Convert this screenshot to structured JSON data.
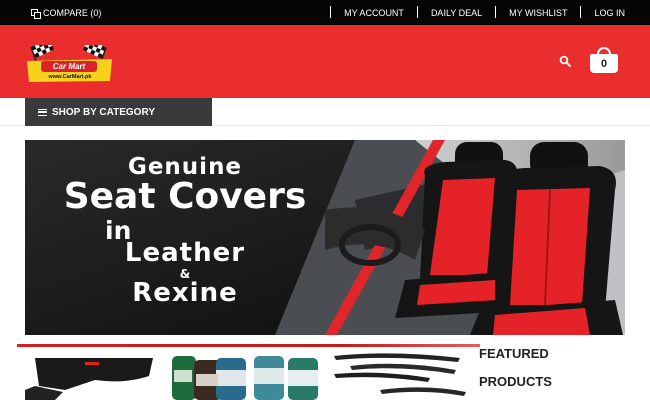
{
  "topbar": {
    "compare_label": "COMPARE (0)",
    "links": [
      "MY ACCOUNT",
      "DAILY DEAL",
      "MY WISHLIST",
      "LOG IN"
    ]
  },
  "header": {
    "logo_text": "Car Mart",
    "logo_url_text": "www.CarMart.pk",
    "cart_count": "0"
  },
  "nav": {
    "category_label": "SHOP BY CATEGORY"
  },
  "banner": {
    "line1": "Genuine",
    "line2": "Seat Covers",
    "line3": "in",
    "line4": "Leather",
    "line5": "&",
    "line6": "Rexine"
  },
  "featured": {
    "line1": "FEATURED",
    "line2": "PRODUCTS"
  },
  "colors": {
    "header_red": "#e92e2d",
    "topbar_black": "#050505",
    "category_dark": "#3a3a3a"
  }
}
